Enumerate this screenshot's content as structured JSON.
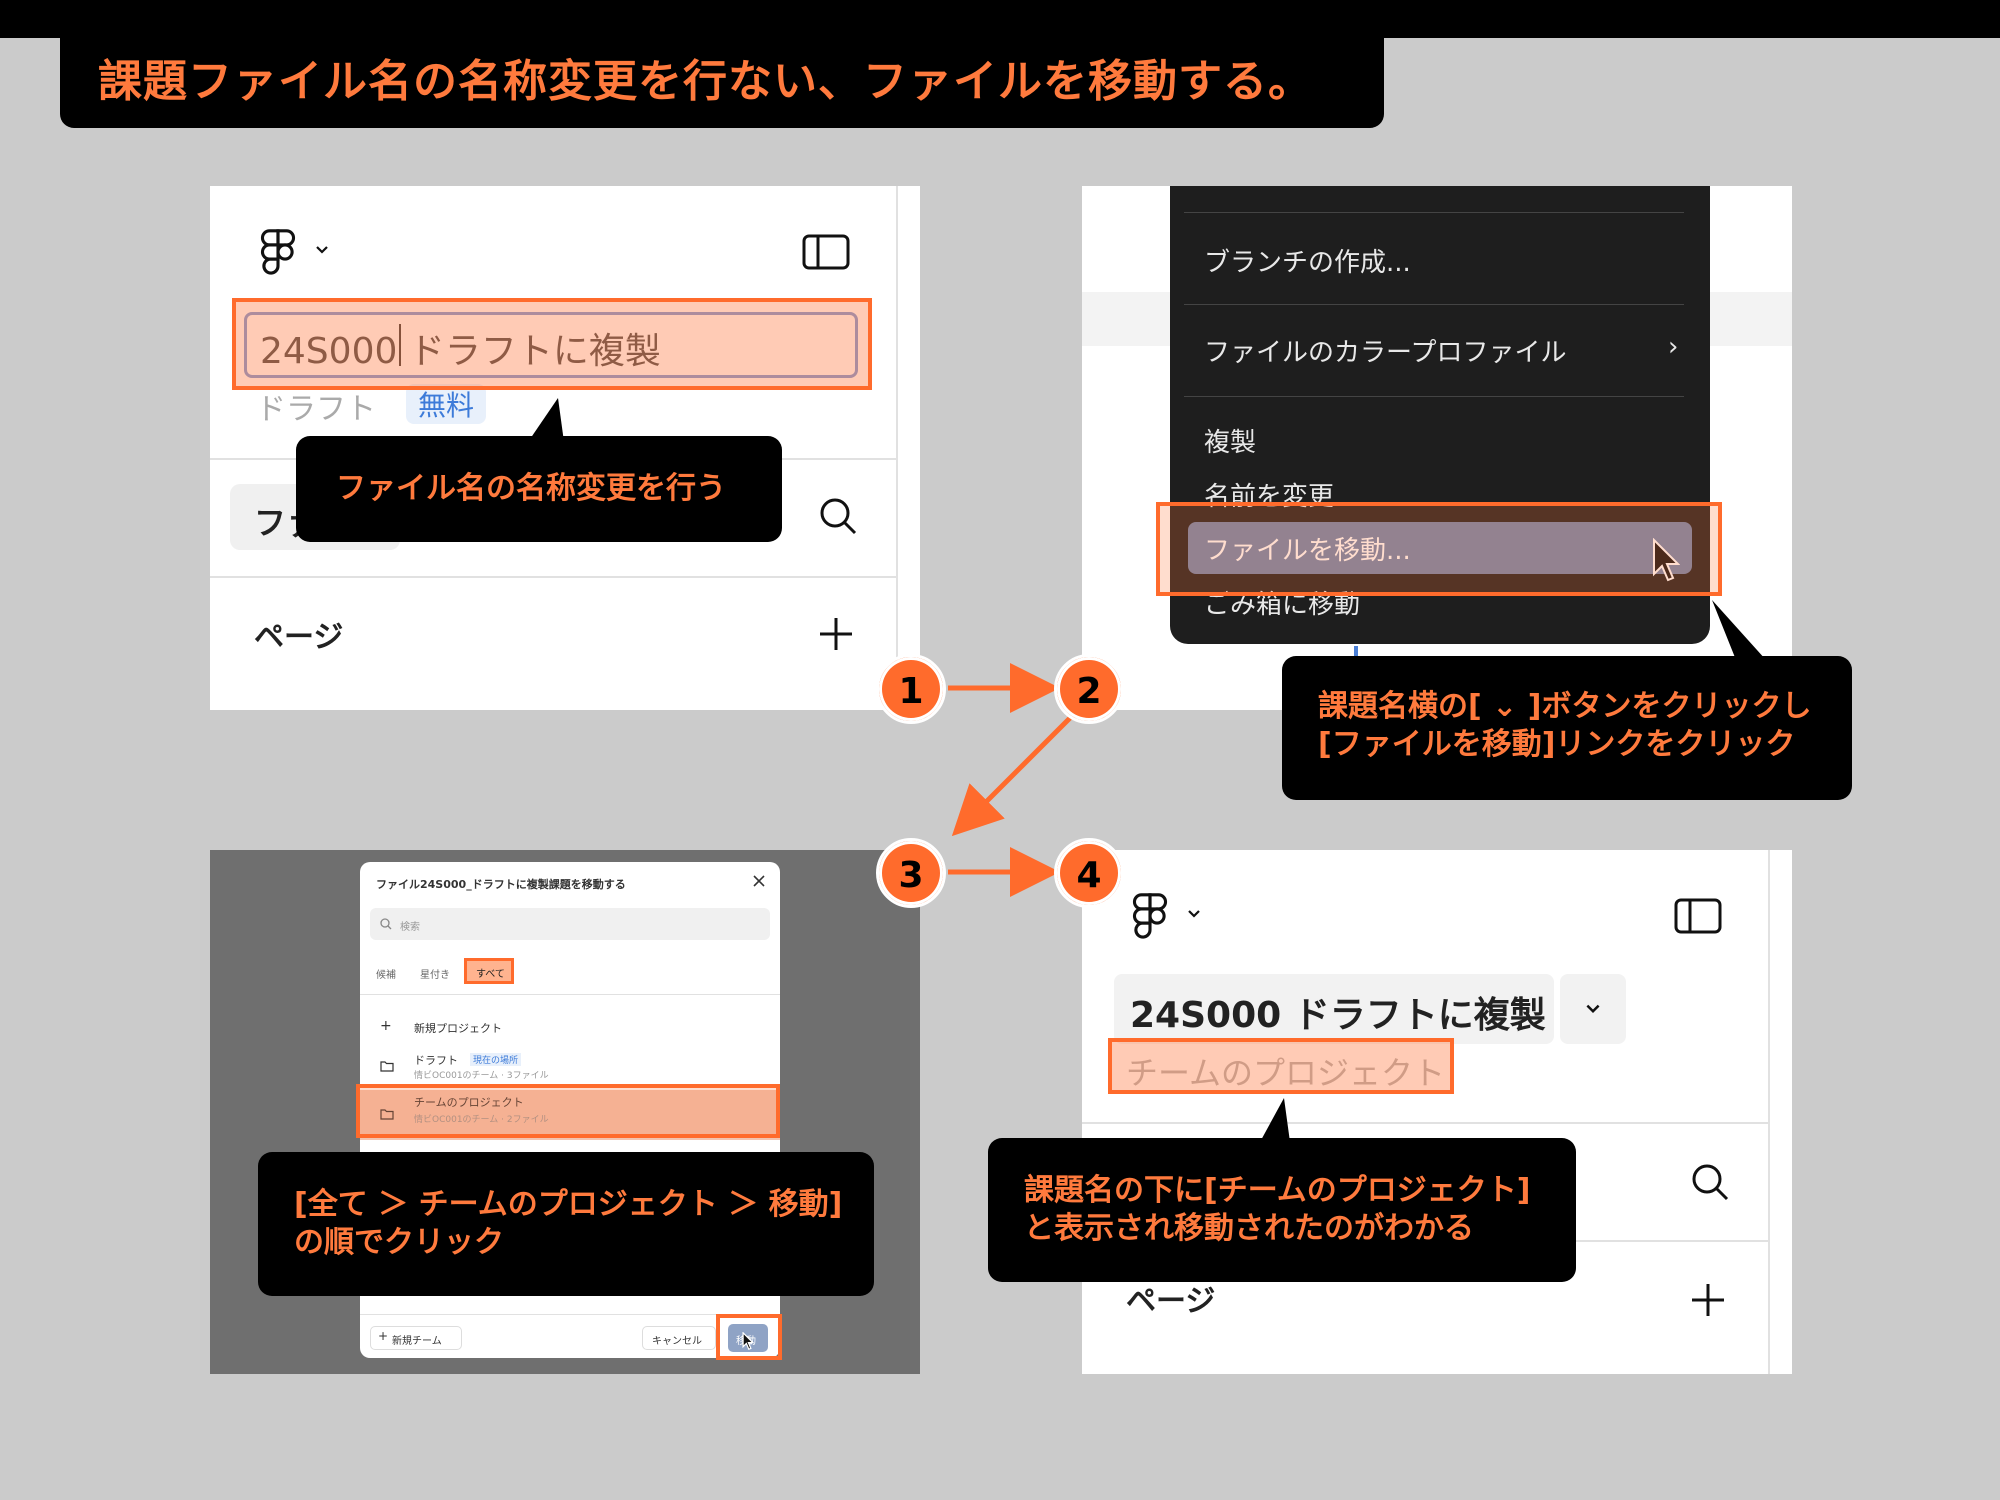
{
  "header": {
    "title": "課題ファイル名の名称変更を行ない、ファイルを移動する。"
  },
  "steps": [
    "1",
    "2",
    "3",
    "4"
  ],
  "panel1": {
    "filename": "24S000 ドラフトに複製",
    "location": "ドラフト",
    "plan_badge": "無料",
    "tab_label": "ファ",
    "pages_label": "ページ",
    "callout": "ファイル名の名称変更を行う"
  },
  "panel2": {
    "menu_items": [
      "ブランチの作成...",
      "ファイルのカラープロファイル",
      "複製",
      "名前を変更",
      "ファイルを移動...",
      "ごみ箱に移動"
    ],
    "submenu_arrow": "›",
    "callout_line1": "課題名横の[ ⌄ ]ボタンをクリックし",
    "callout_line2": "[ファイルを移動]リンクをクリック"
  },
  "panel3": {
    "dialog_title": "ファイル24S000_ドラフトに複製課題を移動する",
    "search_placeholder": "検索",
    "tabs": [
      "候補",
      "星付き",
      "すべて"
    ],
    "new_project": "新規プロジェクト",
    "items": [
      {
        "name": "ドラフト",
        "badge": "現在の場所",
        "sub": "情ビOC001のチーム · 3ファイル"
      },
      {
        "name": "チームのプロジェクト",
        "badge": "",
        "sub": "情ビOC001のチーム · 2ファイル"
      }
    ],
    "new_team": "新規チーム",
    "cancel": "キャンセル",
    "move": "移動",
    "callout_line1": "[全て ＞ チームのプロジェクト ＞ 移動]",
    "callout_line2": "の順でクリック"
  },
  "panel4": {
    "filename": "24S000 ドラフトに複製",
    "location": "チームのプロジェクト",
    "pages_label": "ページ",
    "callout_line1": "課題名の下に[チームのプロジェクト]",
    "callout_line2": "と表示され移動されたのがわかる"
  },
  "colors": {
    "accent": "#ff6b2c",
    "accent_text": "#ff7a3d",
    "menu_bg": "#1e1e1e",
    "menu_hl": "#6f86ad"
  }
}
